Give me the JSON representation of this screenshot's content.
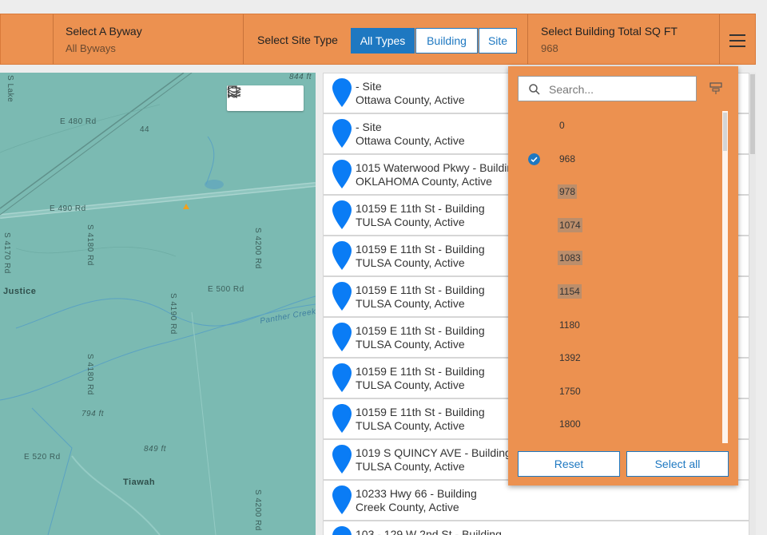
{
  "header": {
    "byway": {
      "label": "Select A Byway",
      "value": "All Byways"
    },
    "site_type": {
      "label": "Select Site Type",
      "buttons": [
        "All Types",
        "Building",
        "Site"
      ],
      "active": "All Types"
    },
    "sqft": {
      "label": "Select Building Total SQ FT",
      "value": "968"
    }
  },
  "map": {
    "labels": {
      "lake": "S Lake",
      "e480": "E 480 Rd",
      "hwy44": "44",
      "e490": "E 490 Rd",
      "s4170": "S 4170 Rd",
      "s4180a": "S 4180 Rd",
      "s4200a": "S 4200 Rd",
      "justice": "Justice",
      "e500": "E 500 Rd",
      "s4190": "S 4190 Rd",
      "panther": "Panther Creek",
      "s4180b": "S 4180 Rd",
      "el794": "794 ft",
      "el849": "849 ft",
      "el844": "844 ft",
      "e520": "E 520 Rd",
      "tiawah": "Tiawah",
      "s4200b": "S 4200 Rd"
    },
    "marker_color": "#f2a11b"
  },
  "list": {
    "items": [
      {
        "title": "- Site",
        "subtitle": "Ottawa County, Active"
      },
      {
        "title": "- Site",
        "subtitle": "Ottawa County, Active"
      },
      {
        "title": "1015 Waterwood Pkwy - Building",
        "subtitle": "OKLAHOMA County, Active"
      },
      {
        "title": "10159 E 11th St - Building",
        "subtitle": "TULSA County, Active"
      },
      {
        "title": "10159 E 11th St - Building",
        "subtitle": "TULSA County, Active"
      },
      {
        "title": "10159 E 11th St - Building",
        "subtitle": "TULSA County, Active"
      },
      {
        "title": "10159 E 11th St - Building",
        "subtitle": "TULSA County, Active"
      },
      {
        "title": "10159 E 11th St - Building",
        "subtitle": "TULSA County, Active"
      },
      {
        "title": "10159 E 11th St - Building",
        "subtitle": "TULSA County, Active"
      },
      {
        "title": "1019 S QUINCY AVE - Building",
        "subtitle": "TULSA County, Active"
      },
      {
        "title": "10233 Hwy 66 - Building",
        "subtitle": "Creek County, Active"
      },
      {
        "title": "103 - 129 W 2nd St - Building",
        "subtitle": ""
      }
    ]
  },
  "dropdown": {
    "search_placeholder": "Search...",
    "options": [
      {
        "label": "0",
        "selected": false,
        "highlighted": false
      },
      {
        "label": "968",
        "selected": true,
        "highlighted": false
      },
      {
        "label": "978",
        "selected": false,
        "highlighted": true
      },
      {
        "label": "1074",
        "selected": false,
        "highlighted": true
      },
      {
        "label": "1083",
        "selected": false,
        "highlighted": true
      },
      {
        "label": "1154",
        "selected": false,
        "highlighted": true
      },
      {
        "label": "1180",
        "selected": false,
        "highlighted": false
      },
      {
        "label": "1392",
        "selected": false,
        "highlighted": false
      },
      {
        "label": "1750",
        "selected": false,
        "highlighted": false
      },
      {
        "label": "1800",
        "selected": false,
        "highlighted": false
      }
    ],
    "reset_label": "Reset",
    "select_all_label": "Select all"
  },
  "colors": {
    "accent": "#ec9150",
    "primary_blue": "#1e78c1",
    "pin_blue": "#0a7cf5",
    "map_bg": "#7bbab2"
  }
}
